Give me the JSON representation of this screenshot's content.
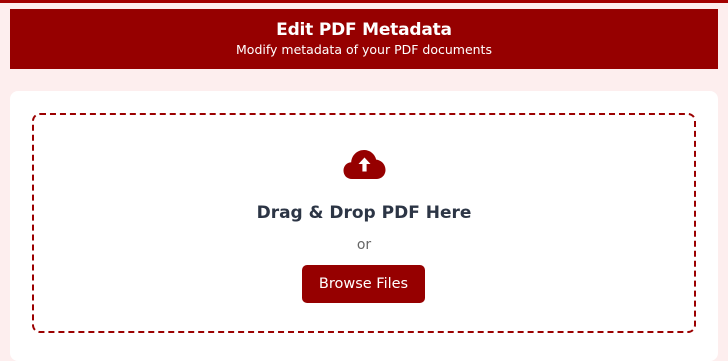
{
  "header": {
    "title": "Edit PDF Metadata",
    "subtitle": "Modify metadata of your PDF documents"
  },
  "upload": {
    "icon": "cloud-upload-icon",
    "title": "Drag & Drop PDF Here",
    "or_label": "or",
    "browse_label": "Browse Files"
  },
  "colors": {
    "brand": "#960000",
    "page_background": "#fdeeee",
    "card_background": "#ffffff",
    "heading_text": "#2c3545",
    "muted_text": "#666666"
  }
}
